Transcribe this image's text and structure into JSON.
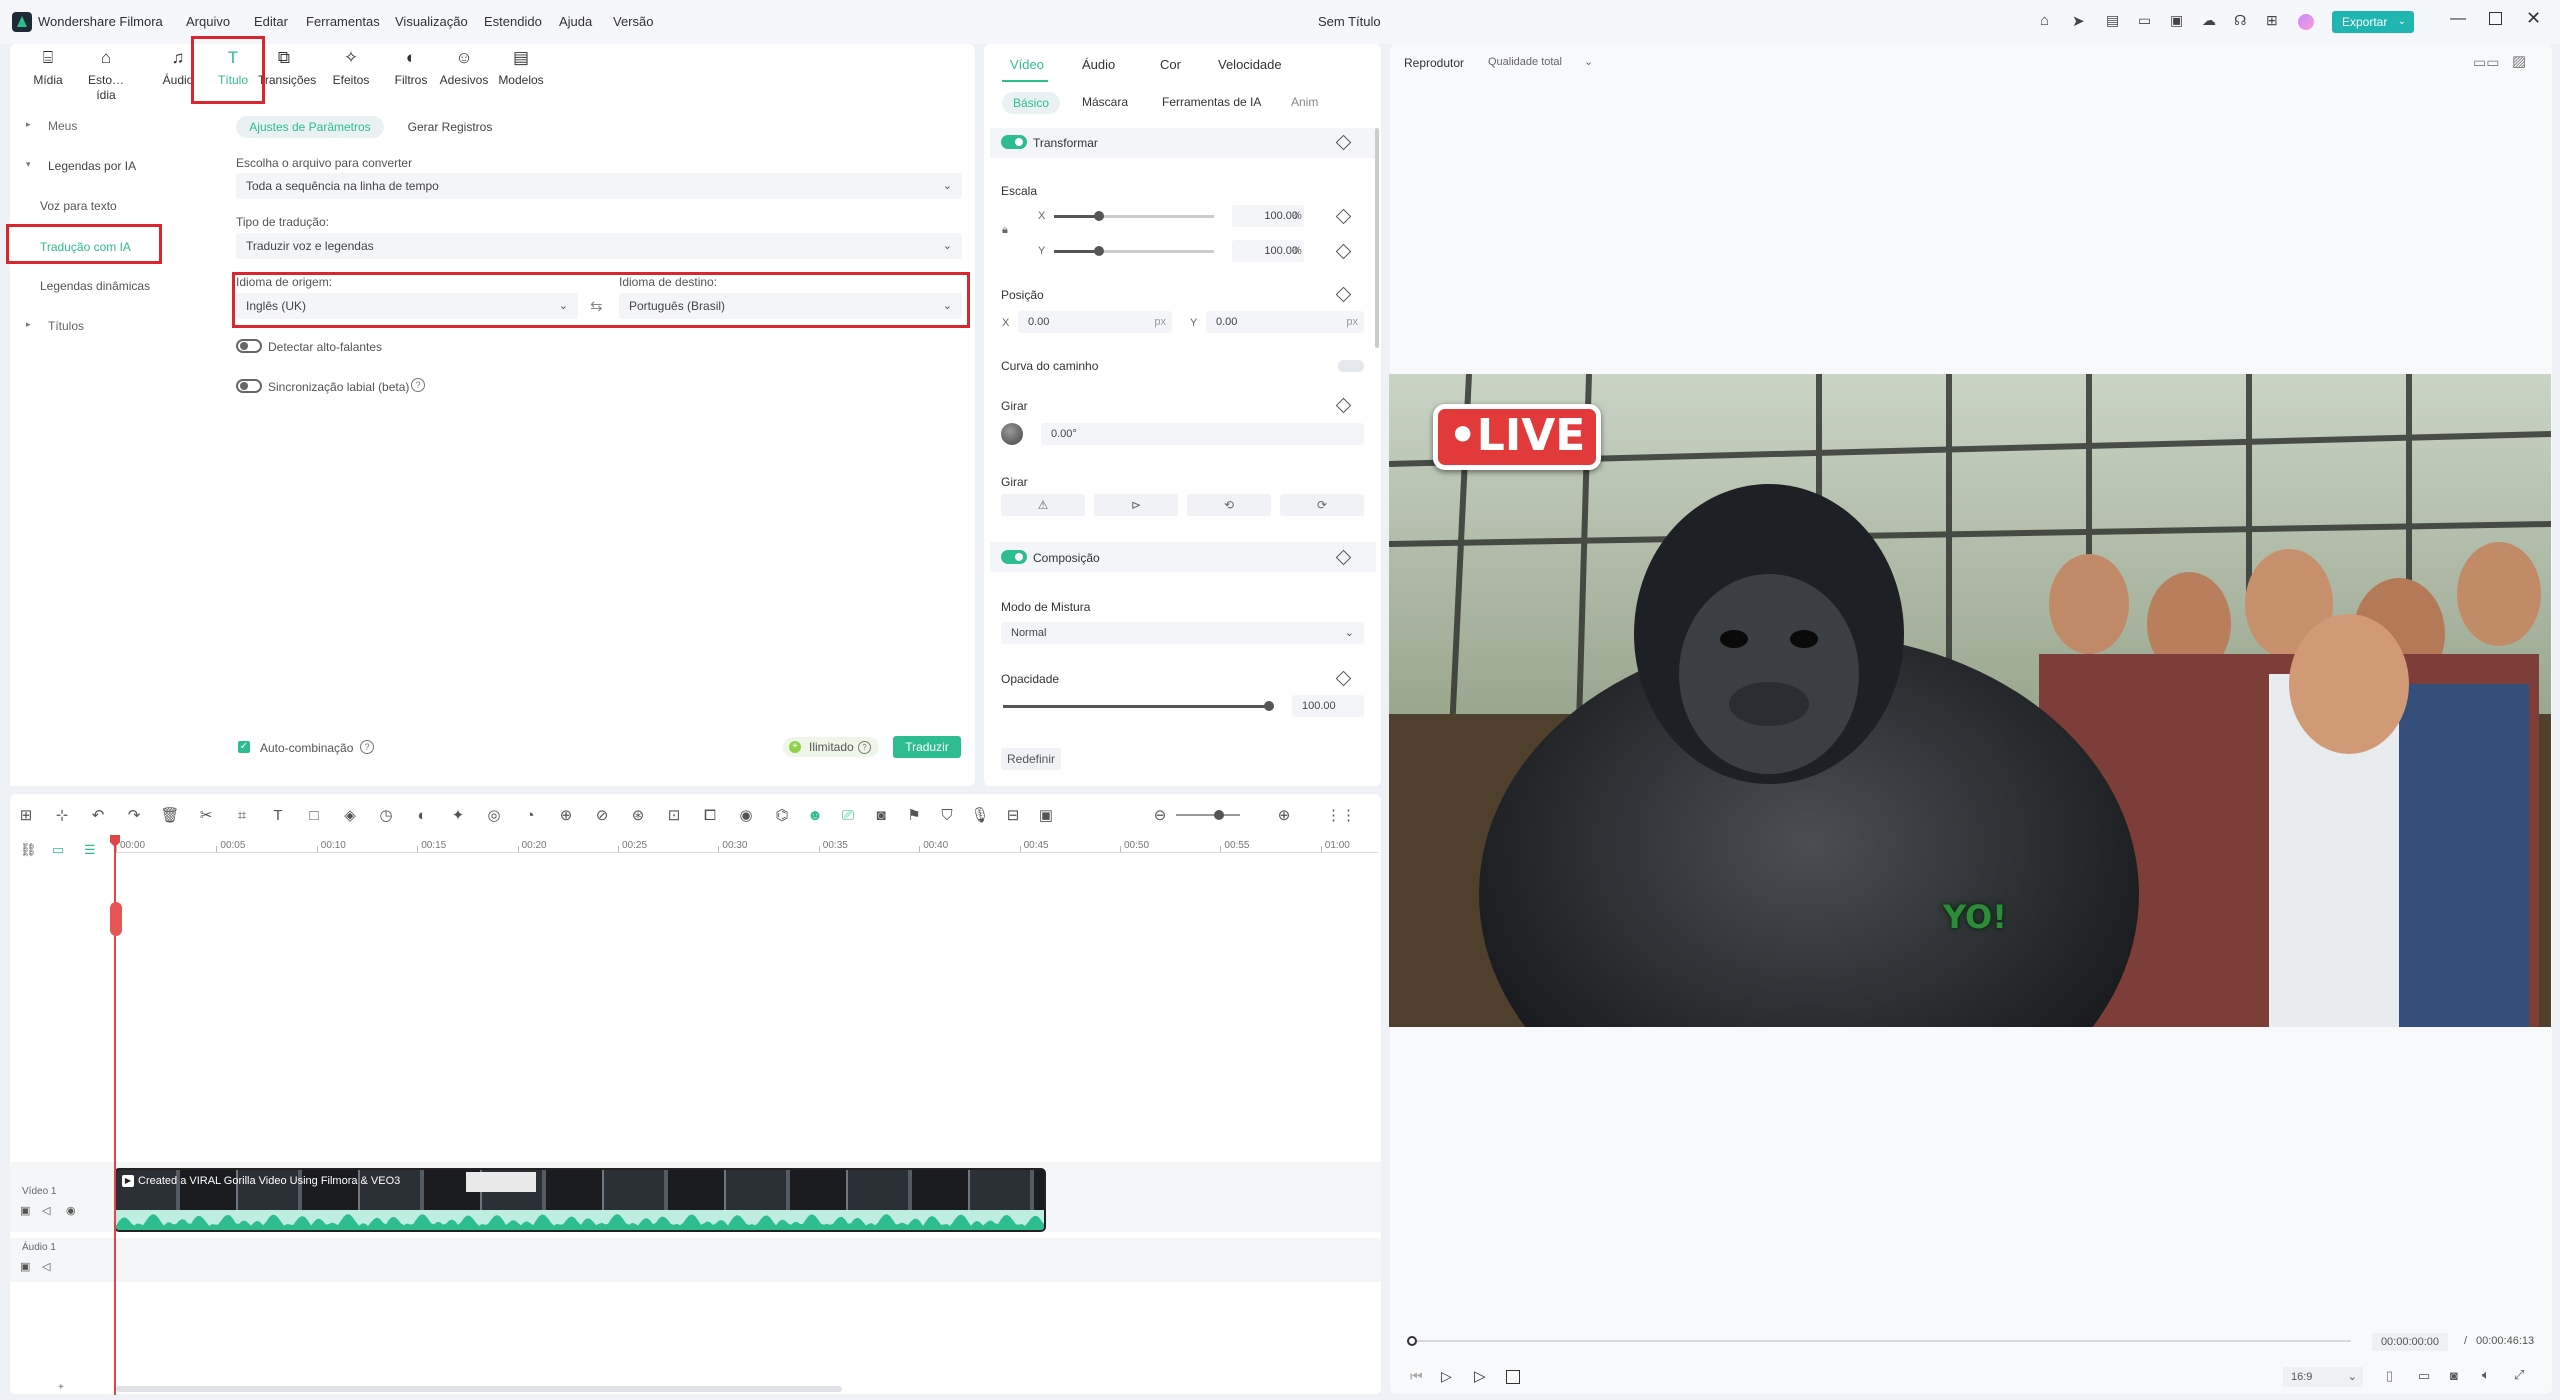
{
  "app": {
    "name": "Wondershare Filmora",
    "doc_title": "Sem Título"
  },
  "menu": [
    "Arquivo",
    "Editar",
    "Ferramentas",
    "Visualização",
    "Estendido",
    "Ajuda",
    "Versão"
  ],
  "export_label": "Exportar",
  "media_tabs": [
    {
      "label": "Mídia",
      "icon": "media-icon"
    },
    {
      "label": "Esto…ídia",
      "icon": "stock-media-icon"
    },
    {
      "label": "Áudio",
      "icon": "audio-note-icon"
    },
    {
      "label": "Título",
      "icon": "title-t-icon"
    },
    {
      "label": "Transições",
      "icon": "transition-icon"
    },
    {
      "label": "Efeitos",
      "icon": "effects-icon"
    },
    {
      "label": "Filtros",
      "icon": "filter-icon"
    },
    {
      "label": "Adesivos",
      "icon": "sticker-icon"
    },
    {
      "label": "Modelos",
      "icon": "template-icon"
    }
  ],
  "sidebar": {
    "items": [
      "Meus",
      "Legendas por IA",
      "Voz para texto",
      "Tradução com IA",
      "Legendas dinâmicas",
      "Títulos"
    ]
  },
  "ai_panel": {
    "tabs": [
      "Ajustes de Parâmetros",
      "Gerar Registros"
    ],
    "choose_label": "Escolha o arquivo para converter",
    "choose_value": "Toda a sequência na linha de tempo",
    "type_label": "Tipo de tradução:",
    "type_value": "Traduzir voz e legendas",
    "source_label": "Idioma de origem:",
    "source_value": "Inglês (UK)",
    "target_label": "Idioma de destino:",
    "target_value": "Português (Brasil)",
    "detect_speakers": "Detectar alto-falantes",
    "lip_sync": "Sincronização labial (beta)",
    "auto_merge": "Auto-combinação",
    "unlimited": "Ilimitado",
    "translate_btn": "Traduzir"
  },
  "props": {
    "tabs": [
      "Vídeo",
      "Áudio",
      "Cor",
      "Velocidade"
    ],
    "subtabs": [
      "Básico",
      "Máscara",
      "Ferramentas de IA",
      "Anim"
    ],
    "transform": "Transformar",
    "scale": "Escala",
    "x_label": "X",
    "y_label": "Y",
    "scale_x": "100.00",
    "scale_y": "100.00",
    "pct": "%",
    "position": "Posição",
    "pos_x": "0.00",
    "pos_y": "0.00",
    "px": "px",
    "path_curve": "Curva do caminho",
    "rotate": "Girar",
    "rotate_value": "0.00°",
    "flip": "Girar",
    "composition": "Composição",
    "blend_mode": "Modo de Mistura",
    "blend_value": "Normal",
    "opacity": "Opacidade",
    "opacity_value": "100.00",
    "reset": "Redefinir",
    "scale_level": 0.28,
    "opacity_level": 1.0
  },
  "player": {
    "label": "Reprodutor",
    "quality": "Qualidade total",
    "current_time": "00:00:00:00",
    "separator": "/",
    "total_time": "00:00:46:13",
    "aspect": "16:9",
    "overlay_live": "•LIVE",
    "overlay_yo": "YO!"
  },
  "timeline": {
    "ticks": [
      "00:00",
      "00:05",
      "00:10",
      "00:15",
      "00:20",
      "00:25",
      "00:30",
      "00:35",
      "00:40",
      "00:45",
      "00:50",
      "00:55",
      "01:00"
    ],
    "video_track": "Vídeo 1",
    "audio_track": "Áudio 1",
    "clip_title": "Created a VIRAL Gorilla Video Using Filmora & VEO3"
  },
  "colors": {
    "accent": "#2ebd8f",
    "highlight": "#d9262f"
  }
}
